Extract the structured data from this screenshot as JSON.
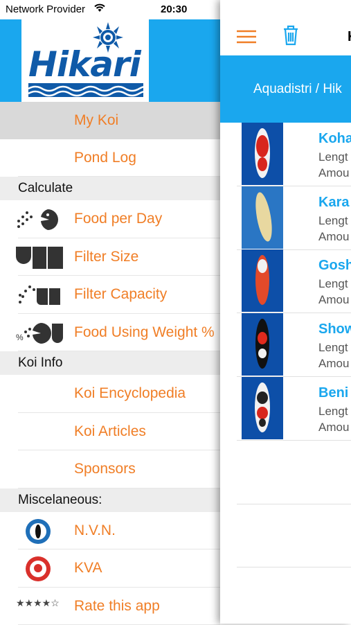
{
  "status_bar": {
    "carrier": "Network Provider",
    "time": "20:30"
  },
  "menu": {
    "logo_text": "Hikari",
    "items_top": [
      {
        "label": "My Koi",
        "selected": true
      },
      {
        "label": "Pond Log"
      }
    ],
    "sections": [
      {
        "title": "Calculate",
        "items": [
          {
            "label": "Food per Day",
            "icon": "food-per-day-icon"
          },
          {
            "label": "Filter Size",
            "icon": "filter-size-icon"
          },
          {
            "label": "Filter Capacity",
            "icon": "filter-capacity-icon"
          },
          {
            "label": "Food Using Weight %",
            "icon": "food-weight-percent-icon"
          }
        ]
      },
      {
        "title": "Koi Info",
        "items": [
          {
            "label": "Koi Encyclopedia"
          },
          {
            "label": "Koi Articles"
          },
          {
            "label": "Sponsors"
          }
        ]
      },
      {
        "title": "Miscelaneous:",
        "items": [
          {
            "label": "N.V.N.",
            "icon": "nvn-logo-icon"
          },
          {
            "label": "KVA",
            "icon": "kva-logo-icon"
          },
          {
            "label": "Rate this app",
            "icon": "rating-stars-icon"
          }
        ]
      }
    ],
    "colors": {
      "accent": "#f07e26",
      "header": "#1aa7ee"
    }
  },
  "panel": {
    "title": "K",
    "banner": "Aquadistri / Hik",
    "koi": [
      {
        "name": "Koha",
        "length": "Lengt",
        "amount": "Amou"
      },
      {
        "name": "Kara",
        "length": "Lengt",
        "amount": "Amou"
      },
      {
        "name": "Gosh",
        "length": "Lengt",
        "amount": "Amou"
      },
      {
        "name": "Show",
        "length": "Lengt",
        "amount": "Amou"
      },
      {
        "name": "Beni",
        "length": "Lengt",
        "amount": "Amou"
      }
    ]
  }
}
